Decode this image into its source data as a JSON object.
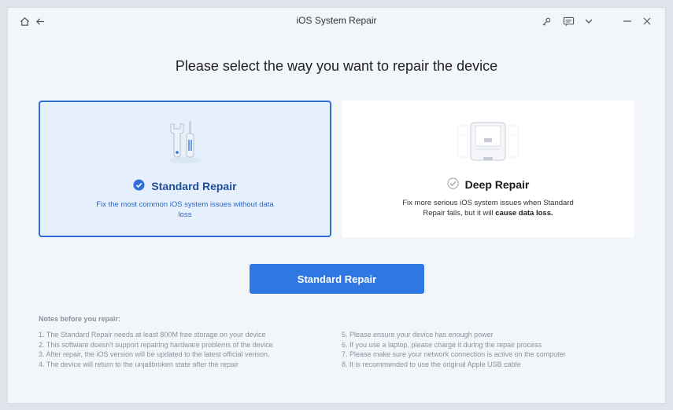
{
  "window": {
    "title": "iOS System Repair"
  },
  "headline": "Please select the way you want to repair the device",
  "cards": [
    {
      "title": "Standard Repair",
      "desc": "Fix the most common iOS system issues without data loss",
      "selected": true
    },
    {
      "title": "Deep Repair",
      "desc_prefix": "Fix more serious iOS system issues when Standard Repair fails, but it will ",
      "desc_warn": "cause data loss.",
      "selected": false
    }
  ],
  "action_button": "Standard Repair",
  "notes": {
    "title": "Notes before you repair:",
    "left": [
      "1.  The Standard Repair needs at least 800M free storage on your device",
      "2.  This software doesn't support repairing hardware problems of the device",
      "3.  After repair, the iOS version will be updated to the latest official verison.",
      "4.  The device will return to the unjailbroken state after the repair"
    ],
    "right": [
      "5.  Please ensure your device has enough power",
      "6.  If you use a laptop, please charge it during the repair process",
      "7.  Please make sure your network connection is active on the computer",
      "8.  It is recommended to use the original Apple USB cable"
    ]
  },
  "colors": {
    "accent": "#2f78e3",
    "selected_border": "#2f6fd7",
    "selected_bg": "#e6f0fd"
  }
}
